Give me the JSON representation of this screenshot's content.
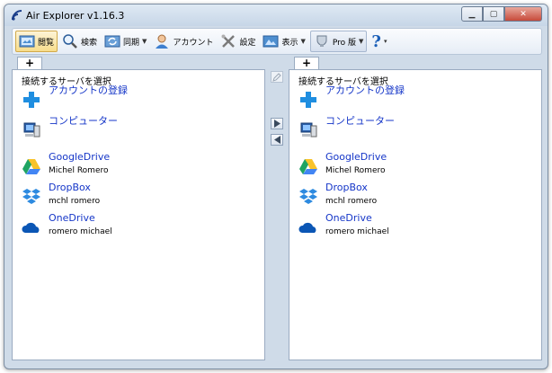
{
  "window": {
    "title": "Air Explorer v1.16.3"
  },
  "toolbar": {
    "browse": "閲覧",
    "search": "検索",
    "sync": "同期",
    "account": "アカウント",
    "settings": "設定",
    "view": "表示",
    "pro": "Pro 版",
    "help_caret": "▾"
  },
  "left_pane": {
    "tab_plus": "+",
    "header": "接続するサーバを選択",
    "items": [
      {
        "label": "アカウントの登録",
        "sub": "",
        "icon": "plus-icon"
      },
      {
        "label": "コンピューター",
        "sub": "",
        "icon": "computer-icon"
      },
      {
        "label": "GoogleDrive",
        "sub": "Michel Romero",
        "icon": "google-drive-icon"
      },
      {
        "label": "DropBox",
        "sub": "mchl romero",
        "icon": "dropbox-icon"
      },
      {
        "label": "OneDrive",
        "sub": "romero michael",
        "icon": "onedrive-icon"
      }
    ]
  },
  "right_pane": {
    "tab_plus": "+",
    "header": "接続するサーバを選択",
    "items": [
      {
        "label": "アカウントの登録",
        "sub": "",
        "icon": "plus-icon"
      },
      {
        "label": "コンピューター",
        "sub": "",
        "icon": "computer-icon"
      },
      {
        "label": "GoogleDrive",
        "sub": "Michel Romero",
        "icon": "google-drive-icon"
      },
      {
        "label": "DropBox",
        "sub": "mchl romero",
        "icon": "dropbox-icon"
      },
      {
        "label": "OneDrive",
        "sub": "romero michael",
        "icon": "onedrive-icon"
      }
    ]
  },
  "colors": {
    "link": "#1536c8",
    "window_frame": "#cfdbe8"
  }
}
